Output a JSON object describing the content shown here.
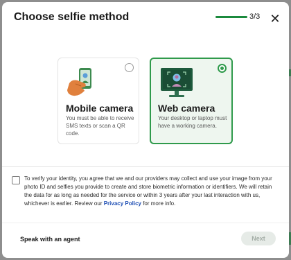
{
  "modal": {
    "title": "Choose selfie method",
    "step": "3/3",
    "close_glyph": "✕"
  },
  "options": [
    {
      "title": "Mobile camera",
      "description": "You must be able to receive SMS texts or scan a QR code.",
      "selected": false,
      "icon": "hand-holding-phone-icon"
    },
    {
      "title": "Web camera",
      "description": "Your desktop or laptop must have a working camera.",
      "selected": true,
      "icon": "computer-monitor-selfie-icon"
    }
  ],
  "consent": {
    "text_before": "To verify your identity, you agree that we and our providers may collect and use your image from your photo ID and selfies you provide to create and store biometric information or identifiers. We will retain the data for as long as needed for the service or within 3 years after your last interaction with us, whichever is earlier. Review our ",
    "link_text": "Privacy Policy",
    "text_after": " for more info.",
    "checked": false
  },
  "footer": {
    "agent_label": "Speak with an agent",
    "next_label": "Next"
  },
  "colors": {
    "accent": "#2f9a4b",
    "link": "#1f4fb4",
    "backdrop": "#8e8e8e"
  }
}
